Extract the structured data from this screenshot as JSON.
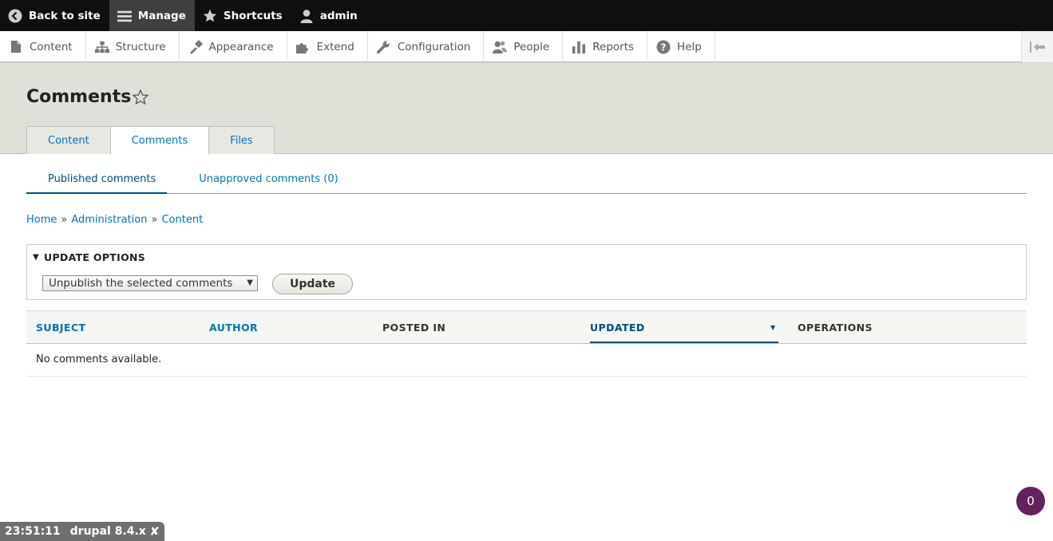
{
  "toolbar": {
    "back_label": "Back to site",
    "manage_label": "Manage",
    "shortcuts_label": "Shortcuts",
    "user_label": "admin"
  },
  "menu": {
    "items": [
      {
        "label": "Content",
        "icon": "file-icon"
      },
      {
        "label": "Structure",
        "icon": "sitemap-icon"
      },
      {
        "label": "Appearance",
        "icon": "paintbrush-icon"
      },
      {
        "label": "Extend",
        "icon": "puzzle-icon"
      },
      {
        "label": "Configuration",
        "icon": "wrench-icon"
      },
      {
        "label": "People",
        "icon": "people-icon"
      },
      {
        "label": "Reports",
        "icon": "bar-chart-icon"
      },
      {
        "label": "Help",
        "icon": "help-icon"
      }
    ]
  },
  "page": {
    "title": "Comments"
  },
  "tabs": [
    {
      "label": "Content"
    },
    {
      "label": "Comments"
    },
    {
      "label": "Files"
    }
  ],
  "subtabs": [
    {
      "label": "Published comments"
    },
    {
      "label": "Unapproved comments (0)"
    }
  ],
  "breadcrumb": [
    {
      "label": "Home"
    },
    {
      "label": "Administration"
    },
    {
      "label": "Content"
    }
  ],
  "update_options": {
    "summary": "UPDATE OPTIONS",
    "select_value": "Unpublish the selected comments",
    "button_label": "Update"
  },
  "table": {
    "headers": {
      "subject": "SUBJECT",
      "author": "AUTHOR",
      "posted_in": "POSTED IN",
      "updated": "UPDATED",
      "operations": "OPERATIONS"
    },
    "empty_message": "No comments available."
  },
  "badge": {
    "count": "0"
  },
  "footer": {
    "time": "23:51:11",
    "version": "drupal 8.4.x",
    "close": "✘"
  },
  "colors": {
    "link": "#0074bd",
    "badge": "#63225f"
  }
}
